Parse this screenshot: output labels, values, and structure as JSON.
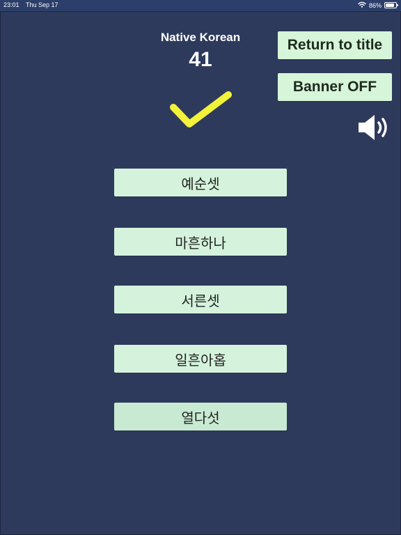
{
  "status_bar": {
    "time": "23:01",
    "date": "Thu Sep 17",
    "battery": "86%",
    "battery_level": 0.86,
    "wifi_icon": "wifi-icon"
  },
  "header": {
    "category": "Native Korean",
    "score": "41",
    "feedback_icon": "checkmark-icon",
    "feedback_color": "#f2f23a"
  },
  "controls": {
    "return_label": "Return to title",
    "banner_label": "Banner OFF",
    "sound_icon": "speaker-icon"
  },
  "answers": [
    {
      "label": "예순셋"
    },
    {
      "label": "마흔하나"
    },
    {
      "label": "서른셋"
    },
    {
      "label": "일흔아홉"
    },
    {
      "label": "열다섯"
    }
  ],
  "colors": {
    "background": "#2e3a5c",
    "button": "#d5f3dc"
  }
}
